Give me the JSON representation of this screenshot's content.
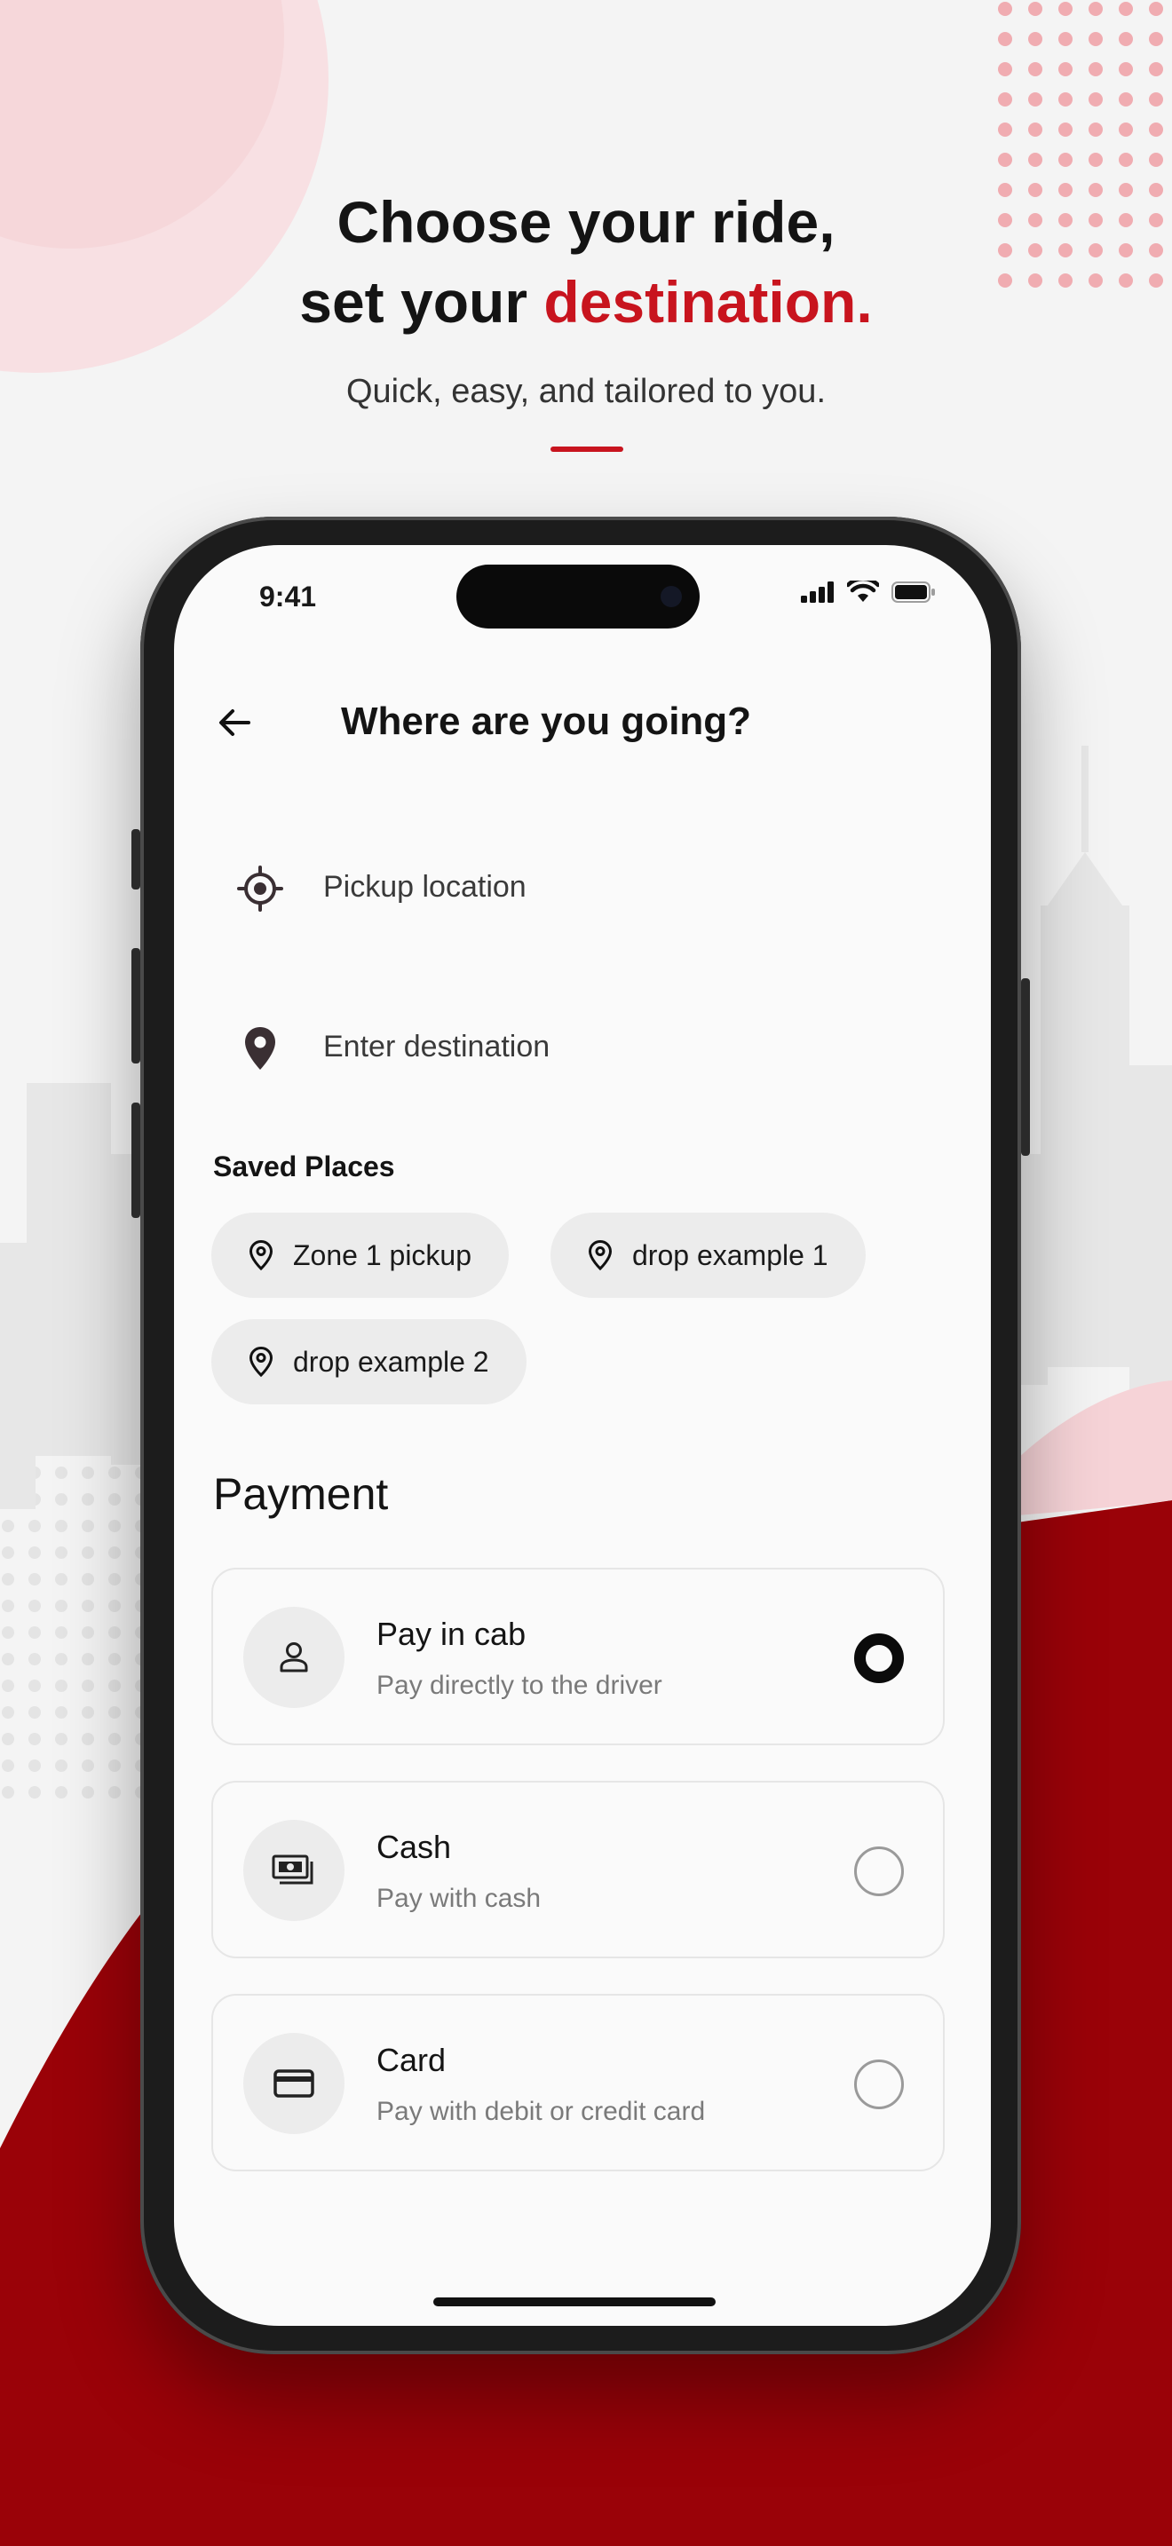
{
  "promo": {
    "headline_line1": "Choose your ride,",
    "headline_line2_prefix": "set your ",
    "headline_line2_accent": "destination.",
    "subtitle": "Quick, easy, and tailored to you.",
    "accent_color": "#c8141e"
  },
  "status_bar": {
    "time": "9:41",
    "icons": [
      "cellular-signal-icon",
      "wifi-icon",
      "battery-icon"
    ]
  },
  "screen": {
    "title": "Where are you going?",
    "back_icon": "arrow-left-icon",
    "pickup": {
      "label": "Pickup location",
      "icon": "target-location-icon"
    },
    "destination": {
      "label": "Enter destination",
      "icon": "map-pin-icon"
    },
    "saved_places": {
      "heading": "Saved Places",
      "items": [
        {
          "label": "Zone 1 pickup",
          "icon": "map-pin-outline-icon"
        },
        {
          "label": "drop example 1",
          "icon": "map-pin-outline-icon"
        },
        {
          "label": "drop example 2",
          "icon": "map-pin-outline-icon"
        }
      ]
    },
    "payment": {
      "heading": "Payment",
      "options": [
        {
          "title": "Pay in cab",
          "description": "Pay directly to the driver",
          "icon": "person-icon",
          "selected": true
        },
        {
          "title": "Cash",
          "description": "Pay with cash",
          "icon": "cash-icon",
          "selected": false
        },
        {
          "title": "Card",
          "description": "Pay with debit or credit card",
          "icon": "credit-card-icon",
          "selected": false
        }
      ]
    }
  },
  "colors": {
    "brand_red": "#c8141e",
    "background_dark_red": "#9a0208",
    "chip_background": "#ececec"
  }
}
